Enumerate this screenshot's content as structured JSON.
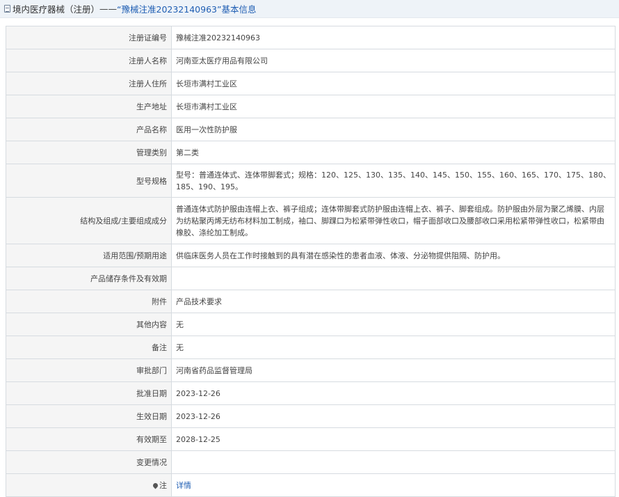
{
  "header": {
    "prefix": "境内医疗器械（注册）",
    "separator": "——",
    "title": "“豫械注准20232140963”基本信息"
  },
  "rows": [
    {
      "label": "注册证编号",
      "value": "豫械注准20232140963"
    },
    {
      "label": "注册人名称",
      "value": "河南亚太医疗用品有限公司"
    },
    {
      "label": "注册人住所",
      "value": "长垣市满村工业区"
    },
    {
      "label": "生产地址",
      "value": "长垣市满村工业区"
    },
    {
      "label": "产品名称",
      "value": "医用一次性防护服"
    },
    {
      "label": "管理类别",
      "value": "第二类"
    },
    {
      "label": "型号规格",
      "value": "型号：普通连体式、连体带脚套式；规格：120、125、130、135、140、145、150、155、160、165、170、175、180、185、190、195。"
    },
    {
      "label": "结构及组成/主要组成成分",
      "value": "普通连体式防护服由连帽上衣、裤子组成；连体带脚套式防护服由连帽上衣、裤子、脚套组成。防护服由外层为聚乙烯膜、内层为纺粘聚丙烯无纺布材料加工制成，袖口、脚踝口为松紧带弹性收口，帽子面部收口及腰部收口采用松紧带弹性收口，松紧带由橡胶、涤纶加工制成。"
    },
    {
      "label": "适用范围/预期用途",
      "value": "供临床医务人员在工作时接触到的具有潜在感染性的患者血液、体液、分泌物提供阻隔、防护用。"
    },
    {
      "label": "产品储存条件及有效期",
      "value": ""
    },
    {
      "label": "附件",
      "value": "产品技术要求"
    },
    {
      "label": "其他内容",
      "value": "无"
    },
    {
      "label": "备注",
      "value": "无"
    },
    {
      "label": "审批部门",
      "value": "河南省药品监督管理局"
    },
    {
      "label": "批准日期",
      "value": "2023-12-26"
    },
    {
      "label": "生效日期",
      "value": "2023-12-26"
    },
    {
      "label": "有效期至",
      "value": "2028-12-25"
    },
    {
      "label": "变更情况",
      "value": ""
    }
  ],
  "note_row": {
    "label": "注",
    "link_text": "详情",
    "icon": "pin-icon"
  }
}
